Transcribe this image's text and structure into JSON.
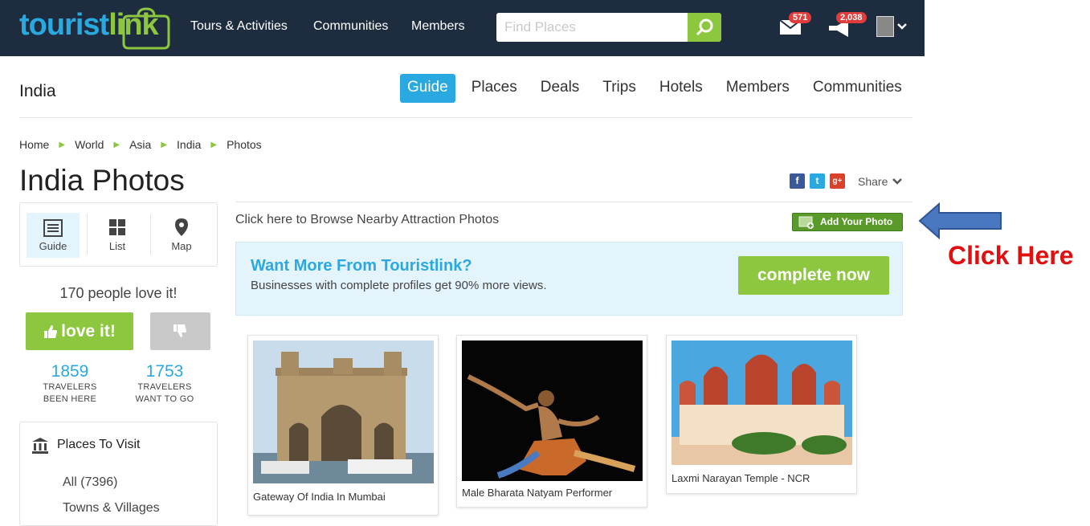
{
  "header": {
    "logo_part1": "tourist",
    "logo_part2": "link",
    "nav": [
      "Tours & Activities",
      "Communities",
      "Members"
    ],
    "search_placeholder": "Find Places",
    "messages_count": "571",
    "notifications_count": "2,038"
  },
  "subnav": {
    "title": "India",
    "tabs": [
      "Guide",
      "Places",
      "Deals",
      "Trips",
      "Hotels",
      "Members",
      "Communities"
    ],
    "active_tab": "Guide"
  },
  "breadcrumb": [
    "Home",
    "World",
    "Asia",
    "India",
    "Photos"
  ],
  "page_title": "India Photos",
  "share_label": "Share",
  "views": [
    "Guide",
    "List",
    "Map"
  ],
  "love": {
    "count_text": "170 people love it!",
    "love_label": "love it!"
  },
  "stats": [
    {
      "num": "1859",
      "line1": "TRAVELERS",
      "line2": "BEEN HERE"
    },
    {
      "num": "1753",
      "line1": "TRAVELERS",
      "line2": "WANT TO GO"
    }
  ],
  "places": {
    "heading": "Places To Visit",
    "items": [
      "All (7396)",
      "Towns & Villages"
    ]
  },
  "browse_text": "Click here to Browse Nearby Attraction Photos",
  "add_photo_label": "Add Your Photo",
  "promo": {
    "title": "Want More From Touristlink?",
    "subtitle": "Businesses with complete profiles get 90% more views.",
    "button": "complete now"
  },
  "photos": [
    {
      "caption": "Gateway Of India In Mumbai"
    },
    {
      "caption": "Male Bharata Natyam Performer"
    },
    {
      "caption": "Laxmi Narayan Temple - NCR"
    }
  ],
  "annotation": "Click Here",
  "colors": {
    "accent_blue": "#2aa9e0",
    "accent_green": "#8dc63f",
    "topbar": "#1d2d3f",
    "annotation_red": "#e01010"
  }
}
